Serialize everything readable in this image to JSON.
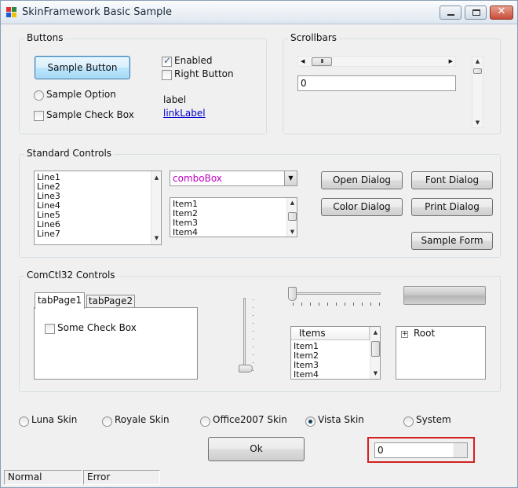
{
  "window": {
    "title": "SkinFramework Basic Sample"
  },
  "buttons_group": {
    "title": "Buttons",
    "sample_button": "Sample Button",
    "sample_option": "Sample Option",
    "sample_checkbox": "Sample Check Box",
    "enabled": "Enabled",
    "enabled_checked": true,
    "right_button": "Right Button",
    "label": "label",
    "link_label": "linkLabel"
  },
  "scrollbars_group": {
    "title": "Scrollbars",
    "textbox_value": "0"
  },
  "standard_group": {
    "title": "Standard Controls",
    "listbox_lines": [
      "Line1",
      "Line2",
      "Line3",
      "Line4",
      "Line5",
      "Line6",
      "Line7"
    ],
    "combo_value": "comboBox",
    "listbox2_items": [
      "Item1",
      "Item2",
      "Item3",
      "Item4"
    ],
    "open_dialog": "Open Dialog",
    "font_dialog": "Font Dialog",
    "color_dialog": "Color Dialog",
    "print_dialog": "Print Dialog",
    "sample_form": "Sample Form"
  },
  "comctl_group": {
    "title": "ComCtl32 Controls",
    "tab1": "tabPage1",
    "tab2": "tabPage2",
    "tab_checkbox": "Some Check Box",
    "listview_header": "Items",
    "listview_items": [
      "Item1",
      "Item2",
      "Item3",
      "Item4"
    ],
    "tree_root": "Root",
    "tree_expander": "+"
  },
  "skins": {
    "options": [
      "Luna Skin",
      "Royale Skin",
      "Office2007 Skin",
      "Vista Skin",
      "System"
    ],
    "selected": "Vista Skin"
  },
  "ok_button": "Ok",
  "bottom_textbox_value": "0",
  "status_bar": {
    "cell1": "Normal",
    "cell2": "Error"
  },
  "colors": {
    "highlight_border": "#d42020",
    "combo_text": "#c000c0",
    "link": "#0000cc"
  }
}
